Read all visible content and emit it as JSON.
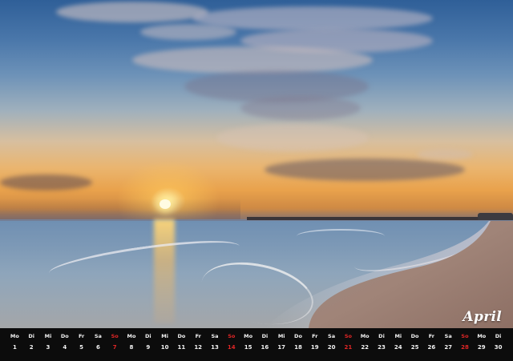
{
  "calendar": {
    "month": "April",
    "accent_sunday_color": "#e02626",
    "days": [
      {
        "weekday": "Mo",
        "day": "1",
        "sunday": false
      },
      {
        "weekday": "Di",
        "day": "2",
        "sunday": false
      },
      {
        "weekday": "Mi",
        "day": "3",
        "sunday": false
      },
      {
        "weekday": "Do",
        "day": "4",
        "sunday": false
      },
      {
        "weekday": "Fr",
        "day": "5",
        "sunday": false
      },
      {
        "weekday": "Sa",
        "day": "6",
        "sunday": false
      },
      {
        "weekday": "So",
        "day": "7",
        "sunday": true
      },
      {
        "weekday": "Mo",
        "day": "8",
        "sunday": false
      },
      {
        "weekday": "Di",
        "day": "9",
        "sunday": false
      },
      {
        "weekday": "Mi",
        "day": "10",
        "sunday": false
      },
      {
        "weekday": "Do",
        "day": "11",
        "sunday": false
      },
      {
        "weekday": "Fr",
        "day": "12",
        "sunday": false
      },
      {
        "weekday": "Sa",
        "day": "13",
        "sunday": false
      },
      {
        "weekday": "So",
        "day": "14",
        "sunday": true
      },
      {
        "weekday": "Mo",
        "day": "15",
        "sunday": false
      },
      {
        "weekday": "Di",
        "day": "16",
        "sunday": false
      },
      {
        "weekday": "Mi",
        "day": "17",
        "sunday": false
      },
      {
        "weekday": "Do",
        "day": "18",
        "sunday": false
      },
      {
        "weekday": "Fr",
        "day": "19",
        "sunday": false
      },
      {
        "weekday": "Sa",
        "day": "20",
        "sunday": false
      },
      {
        "weekday": "So",
        "day": "21",
        "sunday": true
      },
      {
        "weekday": "Mo",
        "day": "22",
        "sunday": false
      },
      {
        "weekday": "Di",
        "day": "23",
        "sunday": false
      },
      {
        "weekday": "Mi",
        "day": "24",
        "sunday": false
      },
      {
        "weekday": "Do",
        "day": "25",
        "sunday": false
      },
      {
        "weekday": "Fr",
        "day": "26",
        "sunday": false
      },
      {
        "weekday": "Sa",
        "day": "27",
        "sunday": false
      },
      {
        "weekday": "So",
        "day": "28",
        "sunday": true
      },
      {
        "weekday": "Mo",
        "day": "29",
        "sunday": false
      },
      {
        "weekday": "Di",
        "day": "30",
        "sunday": false
      }
    ]
  }
}
